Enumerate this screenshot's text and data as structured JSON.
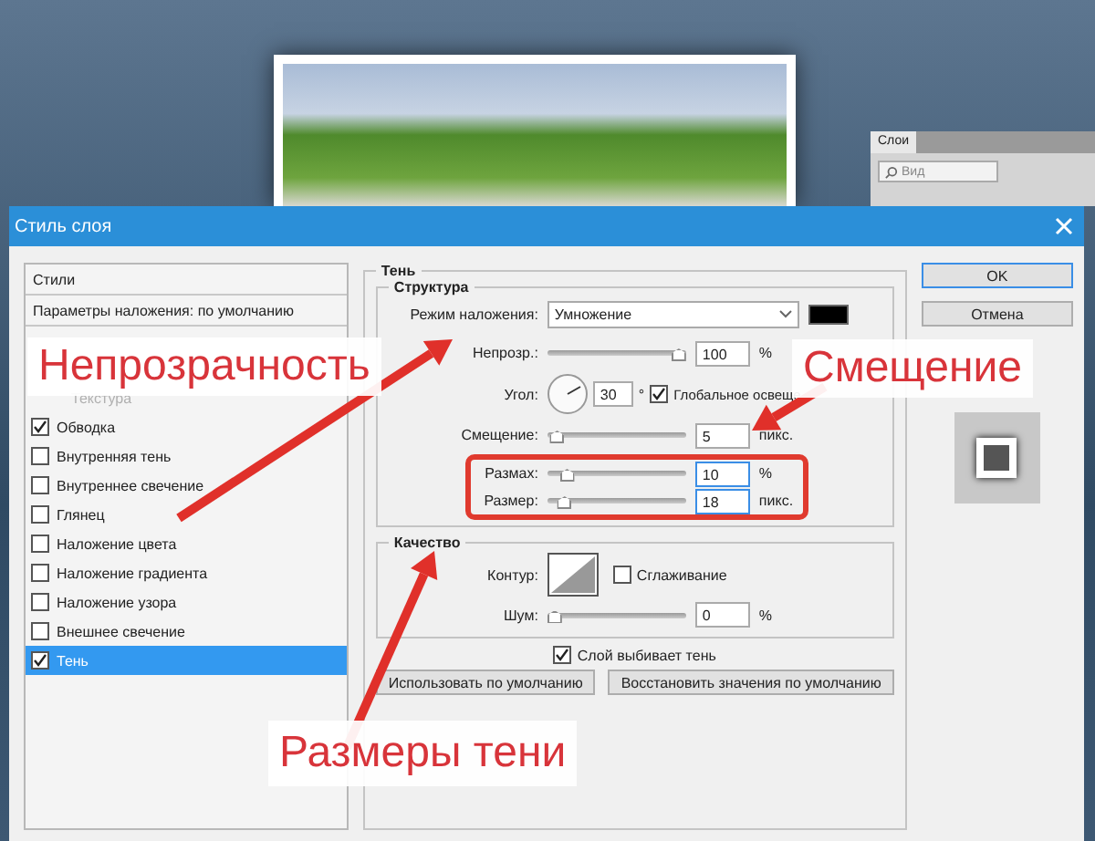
{
  "canvas": {
    "layers_panel": {
      "tab": "Слои",
      "search_placeholder": "Вид"
    }
  },
  "dialog": {
    "title": "Стиль слоя"
  },
  "styles_panel": {
    "header": "Стили",
    "blending_options": "Параметры наложения: по умолчанию",
    "effects": [
      {
        "kind": "sub",
        "label": "Текстура"
      },
      {
        "kind": "check",
        "label": "Обводка",
        "checked": true,
        "selected": false
      },
      {
        "kind": "check",
        "label": "Внутренняя тень",
        "checked": false,
        "selected": false
      },
      {
        "kind": "check",
        "label": "Внутреннее свечение",
        "checked": false,
        "selected": false
      },
      {
        "kind": "check",
        "label": "Глянец",
        "checked": false,
        "selected": false
      },
      {
        "kind": "check",
        "label": "Наложение цвета",
        "checked": false,
        "selected": false
      },
      {
        "kind": "check",
        "label": "Наложение градиента",
        "checked": false,
        "selected": false
      },
      {
        "kind": "check",
        "label": "Наложение узора",
        "checked": false,
        "selected": false
      },
      {
        "kind": "check",
        "label": "Внешнее свечение",
        "checked": false,
        "selected": false
      },
      {
        "kind": "check",
        "label": "Тень",
        "checked": true,
        "selected": true
      }
    ]
  },
  "effect": {
    "title": "Тень",
    "structure": {
      "title": "Структура",
      "blend_mode": {
        "label": "Режим наложения:",
        "value": "Умножение"
      },
      "rows": [
        {
          "kind": "slider",
          "label": "Непрозр.:",
          "level": 1,
          "value": "100",
          "unit": "%",
          "highlighted": false
        },
        {
          "kind": "angle",
          "label": "Угол:",
          "value": "30",
          "unit": "°",
          "global_light": {
            "label": "Глобальное освеще",
            "checked": true
          },
          "highlighted": false
        },
        {
          "kind": "slider",
          "label": "Смещение:",
          "level": 0.02,
          "value": "5",
          "unit": "пикс.",
          "highlighted": false
        },
        {
          "kind": "slider",
          "label": "Размах:",
          "level": 0.1,
          "value": "10",
          "unit": "%",
          "highlighted": true
        },
        {
          "kind": "slider",
          "label": "Размер:",
          "level": 0.08,
          "value": "18",
          "unit": "пикс.",
          "highlighted": true
        }
      ]
    },
    "quality": {
      "title": "Качество",
      "contour_label": "Контур:",
      "antialias": {
        "label": "Сглаживание",
        "checked": false
      },
      "noise": {
        "label": "Шум:",
        "level": 0,
        "value": "0",
        "unit": "%"
      }
    },
    "knockout": {
      "label": "Слой выбивает тень",
      "checked": true
    },
    "buttons": [
      "Использовать по умолчанию",
      "Восстановить значения по умолчанию"
    ]
  },
  "side_buttons": [
    {
      "label": "OK",
      "default": true
    },
    {
      "label": "Отмена",
      "default": false
    }
  ],
  "annotations": [
    {
      "text": "Непрозрачность"
    },
    {
      "text": "Смещение"
    },
    {
      "text": "Размеры тени"
    }
  ]
}
